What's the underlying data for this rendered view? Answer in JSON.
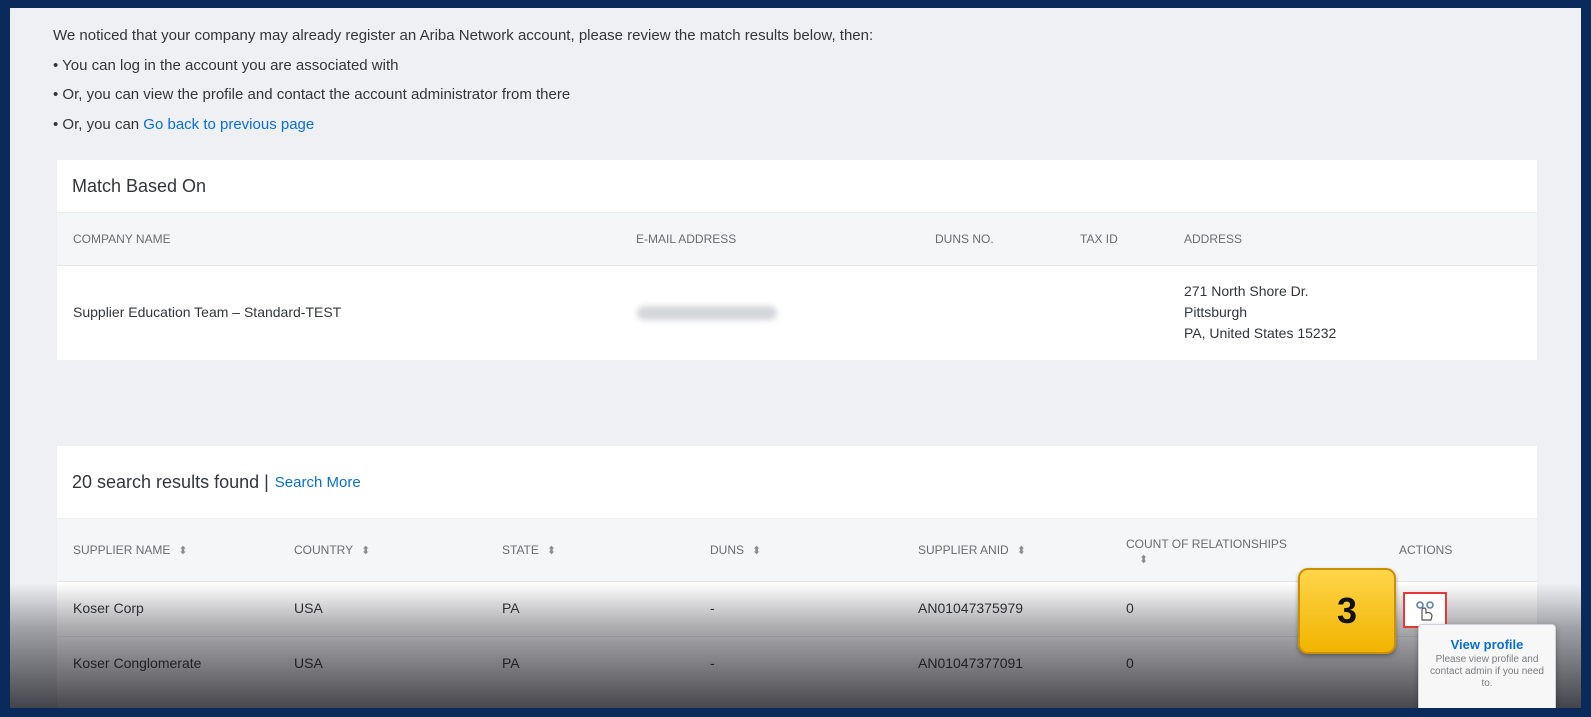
{
  "intro": {
    "lead": "We noticed that your company may already register an Ariba Network account, please review the match results below, then:",
    "bullet1": "• You can log in the account you are associated with",
    "bullet2": "• Or, you can view the profile and contact the account administrator from there",
    "bullet3_prefix": "• Or, you can ",
    "bullet3_link": "Go back to previous page"
  },
  "match": {
    "title": "Match Based On",
    "headers": {
      "company": "COMPANY NAME",
      "email": "E-MAIL ADDRESS",
      "duns": "DUNS NO.",
      "tax": "TAX ID",
      "address": "ADDRESS"
    },
    "row": {
      "company": "Supplier Education Team – Standard-TEST",
      "address_line1": "271 North Shore Dr.",
      "address_line2": "Pittsburgh",
      "address_line3": "PA, United States 15232"
    }
  },
  "results": {
    "summary": "20 search results found |",
    "search_more": "Search More",
    "headers": {
      "supplier": "SUPPLIER NAME",
      "country": "COUNTRY",
      "state": "STATE",
      "duns": "DUNS",
      "anid": "SUPPLIER ANID",
      "count": "COUNT OF RELATIONSHIPS",
      "actions": "ACTIONS"
    },
    "rows": [
      {
        "supplier": "Koser Corp",
        "country": "USA",
        "state": "PA",
        "duns": "-",
        "anid": "AN01047375979",
        "count": "0"
      },
      {
        "supplier": "Koser Conglomerate",
        "country": "USA",
        "state": "PA",
        "duns": "-",
        "anid": "AN01047377091",
        "count": "0"
      }
    ]
  },
  "step": {
    "number": "3"
  },
  "tooltip": {
    "title": "View profile",
    "body": "Please view profile and contact admin if you need to."
  },
  "colors": {
    "link": "#0a6ed1",
    "badge": "#f1b400",
    "highlight": "#e53935"
  },
  "icons": {
    "sort": "sort-icon",
    "view": "view-profile-icon"
  }
}
